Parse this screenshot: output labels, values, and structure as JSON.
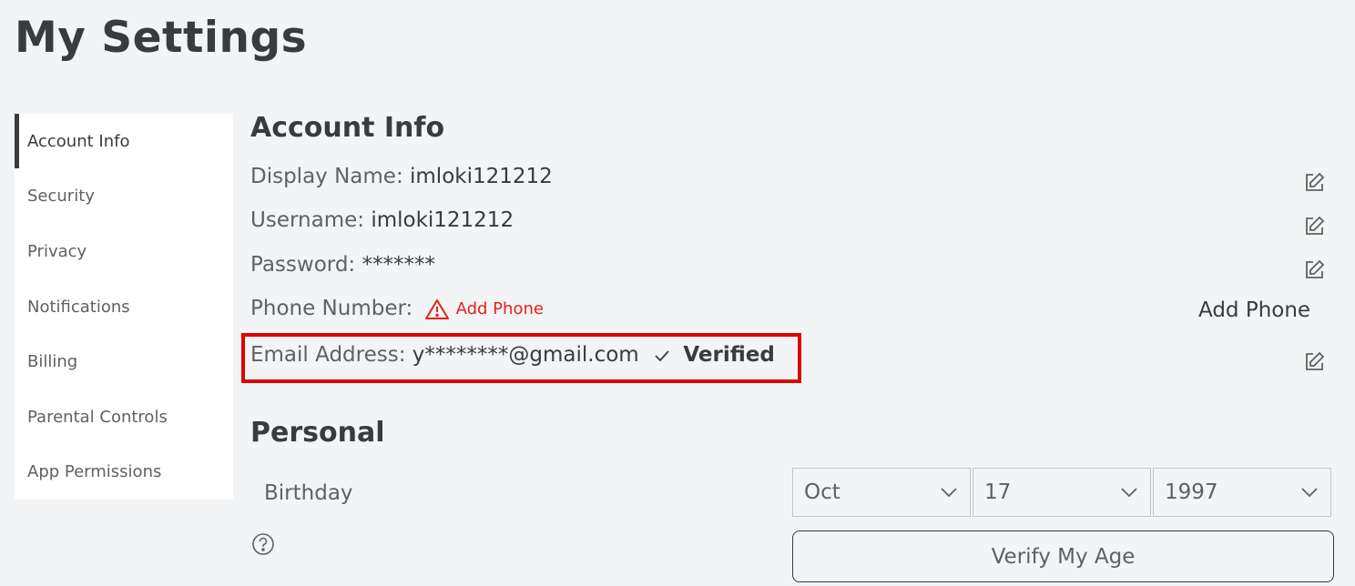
{
  "page": {
    "title": "My Settings"
  },
  "sidebar": {
    "items": [
      {
        "label": "Account Info"
      },
      {
        "label": "Security"
      },
      {
        "label": "Privacy"
      },
      {
        "label": "Notifications"
      },
      {
        "label": "Billing"
      },
      {
        "label": "Parental Controls"
      },
      {
        "label": "App Permissions"
      }
    ],
    "active": "Account Info"
  },
  "account_info": {
    "heading": "Account Info",
    "display_name": {
      "label": "Display Name:",
      "value": "imloki121212"
    },
    "username": {
      "label": "Username:",
      "value": "imloki121212"
    },
    "password": {
      "label": "Password:",
      "value": "*******"
    },
    "phone": {
      "label": "Phone Number:",
      "warning_link": "Add Phone",
      "button": "Add Phone"
    },
    "email": {
      "label": "Email Address:",
      "value": "y********@gmail.com",
      "status": "Verified"
    }
  },
  "personal": {
    "heading": "Personal",
    "birthday_label": "Birthday",
    "month": "Oct",
    "day": "17",
    "year": "1997",
    "verify_button": "Verify My Age"
  },
  "colors": {
    "background": "#f2f4f5",
    "text_primary": "#393b3d",
    "text_secondary": "#606162",
    "warning": "#e2231a",
    "highlight_box": "#e00000"
  },
  "icons": [
    "edit-icon",
    "warning-icon",
    "check-icon",
    "chevron-down-icon",
    "help-icon"
  ]
}
